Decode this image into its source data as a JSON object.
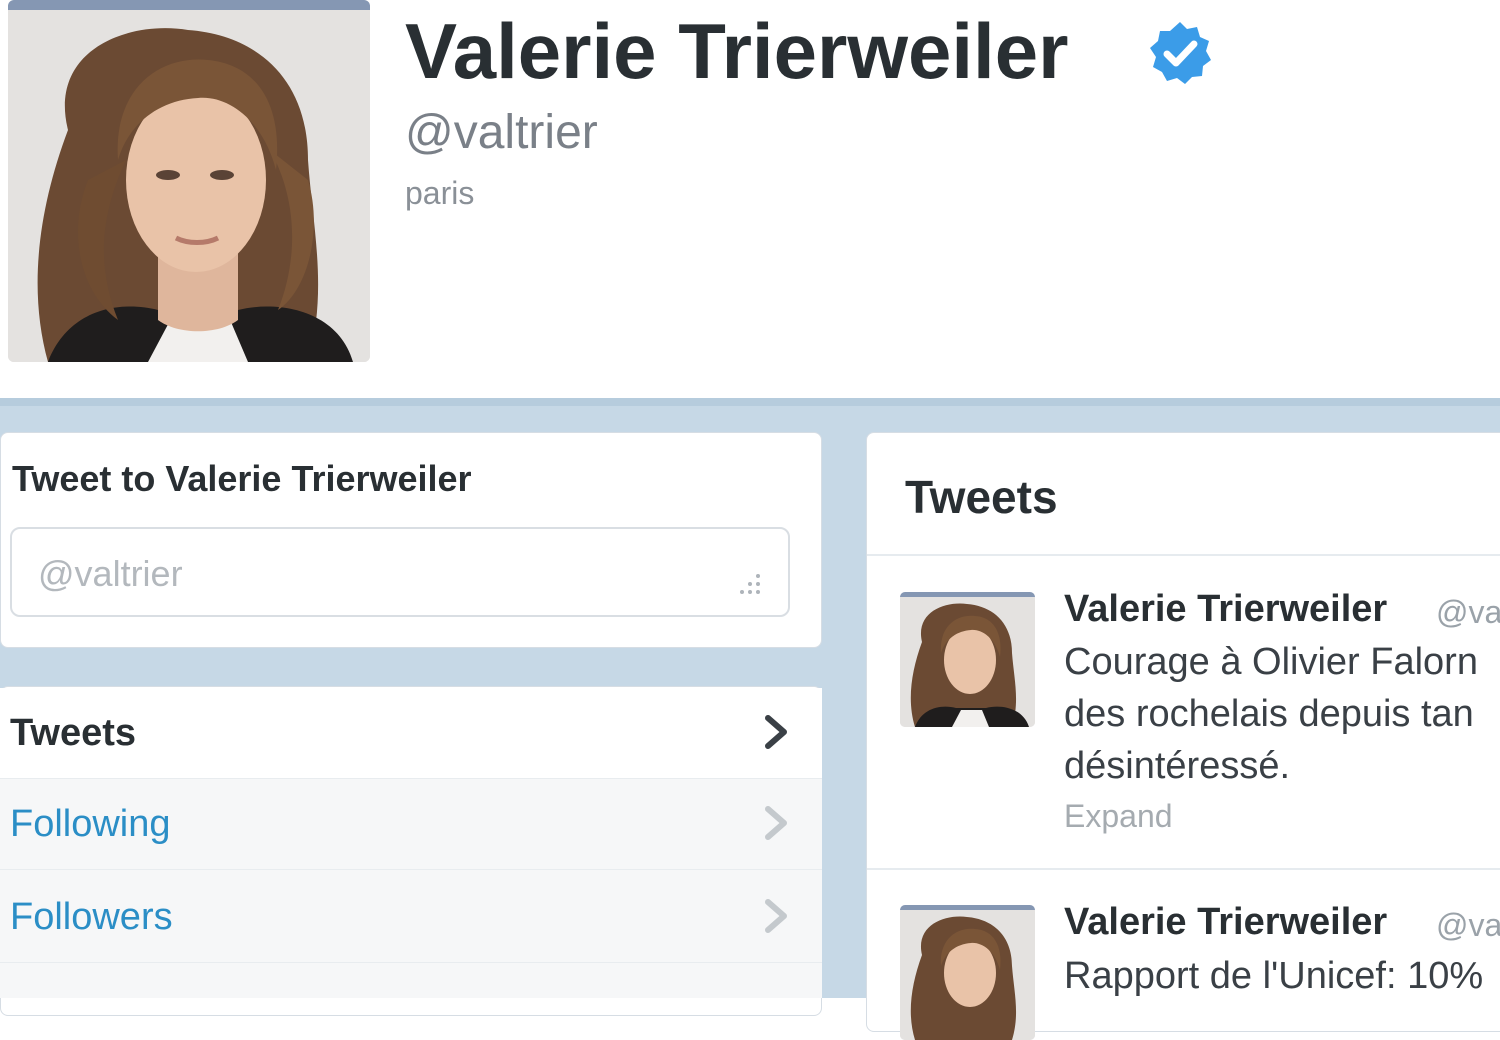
{
  "profile": {
    "name": "Valerie Trierweiler",
    "handle": "@valtrier",
    "location": "paris",
    "verified_color": "#3b9ce8"
  },
  "tweet_to": {
    "title": "Tweet to Valerie Trierweiler",
    "placeholder": "@valtrier"
  },
  "nav": {
    "items": [
      {
        "label": "Tweets"
      },
      {
        "label": "Following"
      },
      {
        "label": "Followers"
      }
    ]
  },
  "timeline": {
    "heading": "Tweets",
    "tweets": [
      {
        "name": "Valerie Trierweiler",
        "handle": "@va",
        "lines": [
          "Courage à Olivier Falorn",
          "des rochelais depuis tan",
          "désintéressé."
        ],
        "expand": "Expand"
      },
      {
        "name": "Valerie Trierweiler",
        "handle": "@va",
        "lines": [
          "Rapport de l'Unicef: 10%"
        ]
      }
    ]
  },
  "colors": {
    "accent": "#2b8ec6",
    "background": "#c6d8e6",
    "text": "#292f33"
  }
}
